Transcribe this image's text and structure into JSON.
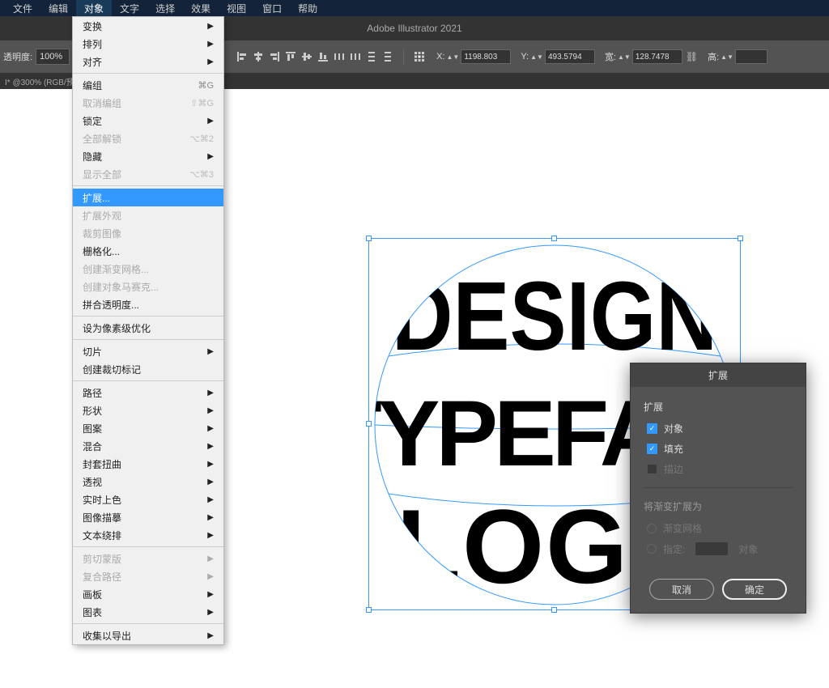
{
  "menubar": {
    "items": [
      "文件",
      "编辑",
      "对象",
      "文字",
      "选择",
      "效果",
      "视图",
      "窗口",
      "帮助"
    ],
    "active_index": 2
  },
  "titlebar": {
    "title": "Adobe Illustrator 2021"
  },
  "controlbar": {
    "opacity_label": "透明度:",
    "opacity_value": "100%",
    "x_label": "X:",
    "x_value": "1198.803",
    "y_label": "Y:",
    "y_value": "493.5794",
    "w_label": "宽:",
    "w_value": "128.7478",
    "h_label": "高:",
    "h_value": ""
  },
  "tab": {
    "name": "I* @300% (RGB/预"
  },
  "dropdown": {
    "items": [
      {
        "label": "变换",
        "arrow": true
      },
      {
        "label": "排列",
        "arrow": true
      },
      {
        "label": "对齐",
        "arrow": true
      },
      {
        "sep": true
      },
      {
        "label": "编组",
        "shortcut": "⌘G"
      },
      {
        "label": "取消编组",
        "shortcut": "⇧⌘G",
        "disabled": true
      },
      {
        "label": "锁定",
        "arrow": true
      },
      {
        "label": "全部解锁",
        "shortcut": "⌥⌘2",
        "disabled": true
      },
      {
        "label": "隐藏",
        "arrow": true
      },
      {
        "label": "显示全部",
        "shortcut": "⌥⌘3",
        "disabled": true
      },
      {
        "sep": true
      },
      {
        "label": "扩展...",
        "highlighted": true
      },
      {
        "label": "扩展外观",
        "disabled": true
      },
      {
        "label": "裁剪图像",
        "disabled": true
      },
      {
        "label": "栅格化..."
      },
      {
        "label": "创建渐变网格...",
        "disabled": true
      },
      {
        "label": "创建对象马赛克...",
        "disabled": true
      },
      {
        "label": "拼合透明度..."
      },
      {
        "sep": true
      },
      {
        "label": "设为像素级优化"
      },
      {
        "sep": true
      },
      {
        "label": "切片",
        "arrow": true
      },
      {
        "label": "创建裁切标记"
      },
      {
        "sep": true
      },
      {
        "label": "路径",
        "arrow": true
      },
      {
        "label": "形状",
        "arrow": true
      },
      {
        "label": "图案",
        "arrow": true
      },
      {
        "label": "混合",
        "arrow": true
      },
      {
        "label": "封套扭曲",
        "arrow": true
      },
      {
        "label": "透视",
        "arrow": true
      },
      {
        "label": "实时上色",
        "arrow": true
      },
      {
        "label": "图像描摹",
        "arrow": true
      },
      {
        "label": "文本绕排",
        "arrow": true
      },
      {
        "sep": true
      },
      {
        "label": "剪切蒙版",
        "arrow": true,
        "disabled": true
      },
      {
        "label": "复合路径",
        "arrow": true,
        "disabled": true
      },
      {
        "label": "画板",
        "arrow": true
      },
      {
        "label": "图表",
        "arrow": true
      },
      {
        "sep": true
      },
      {
        "label": "收集以导出",
        "arrow": true
      }
    ]
  },
  "artwork": {
    "line1": "DESIGN",
    "line2": "TYPEFACE",
    "line3": "LOGO"
  },
  "dialog": {
    "title": "扩展",
    "section1_title": "扩展",
    "check_object": "对象",
    "check_fill": "填充",
    "check_stroke": "描边",
    "section2_title": "将渐变扩展为",
    "radio_gradient": "渐变网格",
    "radio_specify": "指定:",
    "radio_specify_unit": "对象",
    "cancel": "取消",
    "ok": "确定"
  }
}
